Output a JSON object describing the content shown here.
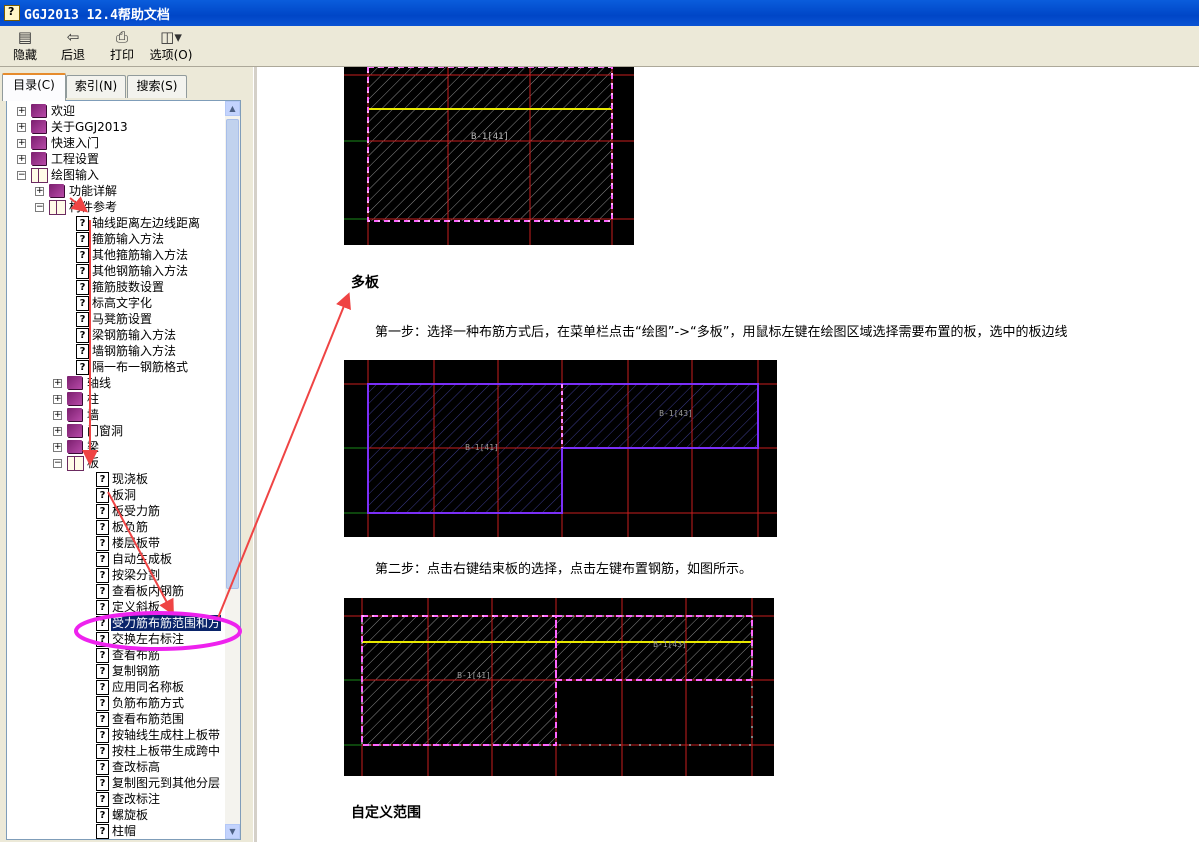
{
  "window": {
    "title": "GGJ2013 12.4帮助文档"
  },
  "toolbar": {
    "hide": {
      "label": "隐藏",
      "icon": "hide-pane-icon"
    },
    "back": {
      "label": "后退",
      "icon": "back-arrow-icon"
    },
    "print": {
      "label": "打印",
      "icon": "printer-icon"
    },
    "options": {
      "label": "选项(O)",
      "icon": "options-icon"
    }
  },
  "tabs": {
    "contents": "目录(C)",
    "index": "索引(N)",
    "search": "搜索(S)"
  },
  "tree": [
    {
      "label": "欢迎",
      "level": 0,
      "kind": "book",
      "state": "collapsed"
    },
    {
      "label": "关于GGJ2013",
      "level": 0,
      "kind": "book",
      "state": "collapsed"
    },
    {
      "label": "快速入门",
      "level": 0,
      "kind": "book",
      "state": "collapsed"
    },
    {
      "label": "工程设置",
      "level": 0,
      "kind": "book",
      "state": "collapsed"
    },
    {
      "label": "绘图输入",
      "level": 0,
      "kind": "book",
      "state": "expanded"
    },
    {
      "label": "功能详解",
      "level": 1,
      "kind": "book",
      "state": "collapsed"
    },
    {
      "label": "构件参考",
      "level": 1,
      "kind": "book",
      "state": "expanded"
    },
    {
      "label": "轴线距离左边线距离",
      "level": 2,
      "kind": "page"
    },
    {
      "label": "箍筋输入方法",
      "level": 2,
      "kind": "page"
    },
    {
      "label": "其他箍筋输入方法",
      "level": 2,
      "kind": "page"
    },
    {
      "label": "其他钢筋输入方法",
      "level": 2,
      "kind": "page"
    },
    {
      "label": "箍筋肢数设置",
      "level": 2,
      "kind": "page"
    },
    {
      "label": "标高文字化",
      "level": 2,
      "kind": "page"
    },
    {
      "label": "马凳筋设置",
      "level": 2,
      "kind": "page"
    },
    {
      "label": "梁钢筋输入方法",
      "level": 2,
      "kind": "page"
    },
    {
      "label": "墙钢筋输入方法",
      "level": 2,
      "kind": "page"
    },
    {
      "label": "隔一布一钢筋格式",
      "level": 2,
      "kind": "page"
    },
    {
      "label": "轴线",
      "level": 2,
      "kind": "book",
      "state": "collapsed"
    },
    {
      "label": "柱",
      "level": 2,
      "kind": "book",
      "state": "collapsed"
    },
    {
      "label": "墙",
      "level": 2,
      "kind": "book",
      "state": "collapsed"
    },
    {
      "label": "门窗洞",
      "level": 2,
      "kind": "book",
      "state": "collapsed"
    },
    {
      "label": "梁",
      "level": 2,
      "kind": "book",
      "state": "collapsed"
    },
    {
      "label": "板",
      "level": 2,
      "kind": "book",
      "state": "expanded"
    },
    {
      "label": "现浇板",
      "level": 3,
      "kind": "page"
    },
    {
      "label": "板洞",
      "level": 3,
      "kind": "page"
    },
    {
      "label": "板受力筋",
      "level": 3,
      "kind": "page"
    },
    {
      "label": "板负筋",
      "level": 3,
      "kind": "page"
    },
    {
      "label": "楼层板带",
      "level": 3,
      "kind": "page"
    },
    {
      "label": "自动生成板",
      "level": 3,
      "kind": "page"
    },
    {
      "label": "按梁分割",
      "level": 3,
      "kind": "page"
    },
    {
      "label": "查看板内钢筋",
      "level": 3,
      "kind": "page"
    },
    {
      "label": "定义斜板",
      "level": 3,
      "kind": "page"
    },
    {
      "label": "受力筋布筋范围和方",
      "level": 3,
      "kind": "page",
      "selected": true
    },
    {
      "label": "交换左右标注",
      "level": 3,
      "kind": "page"
    },
    {
      "label": "查看布筋",
      "level": 3,
      "kind": "page"
    },
    {
      "label": "复制钢筋",
      "level": 3,
      "kind": "page"
    },
    {
      "label": "应用同名称板",
      "level": 3,
      "kind": "page"
    },
    {
      "label": "负筋布筋方式",
      "level": 3,
      "kind": "page"
    },
    {
      "label": "查看布筋范围",
      "level": 3,
      "kind": "page"
    },
    {
      "label": "按轴线生成柱上板带",
      "level": 3,
      "kind": "page"
    },
    {
      "label": "按柱上板带生成跨中",
      "level": 3,
      "kind": "page"
    },
    {
      "label": "查改标高",
      "level": 3,
      "kind": "page"
    },
    {
      "label": "复制图元到其他分层",
      "level": 3,
      "kind": "page"
    },
    {
      "label": "查改标注",
      "level": 3,
      "kind": "page"
    },
    {
      "label": "螺旋板",
      "level": 3,
      "kind": "page"
    },
    {
      "label": "柱帽",
      "level": 3,
      "kind": "page"
    }
  ],
  "content": {
    "section1_title": "多板",
    "step1": "第一步：选择一种布筋方式后，在菜单栏点击“绘图”->“多板”，用鼠标左键在绘图区域选择需要布置的板，选中的板边线",
    "step2": "第二步：点击右键结束板的选择，点击左键布置钢筋，如图所示。",
    "section2_title": "自定义范围",
    "figure_labels": {
      "fig1_slab": "B-1[41]",
      "fig2_slab_left": "B-1[41]",
      "fig2_slab_right": "B-1[43]",
      "fig3_slab_left": "B-1[41]",
      "fig3_slab_right": "B-1[43]"
    }
  },
  "colors": {
    "titlebar": "#0046c7",
    "selection": "#0a246a",
    "annotation_arrow": "#ef4444",
    "annotation_ellipse": "#ee22ee",
    "cad_grid": "#c81e1e",
    "cad_slab_outline": "#7b2ff7",
    "cad_rebar_line": "#e8e800"
  }
}
